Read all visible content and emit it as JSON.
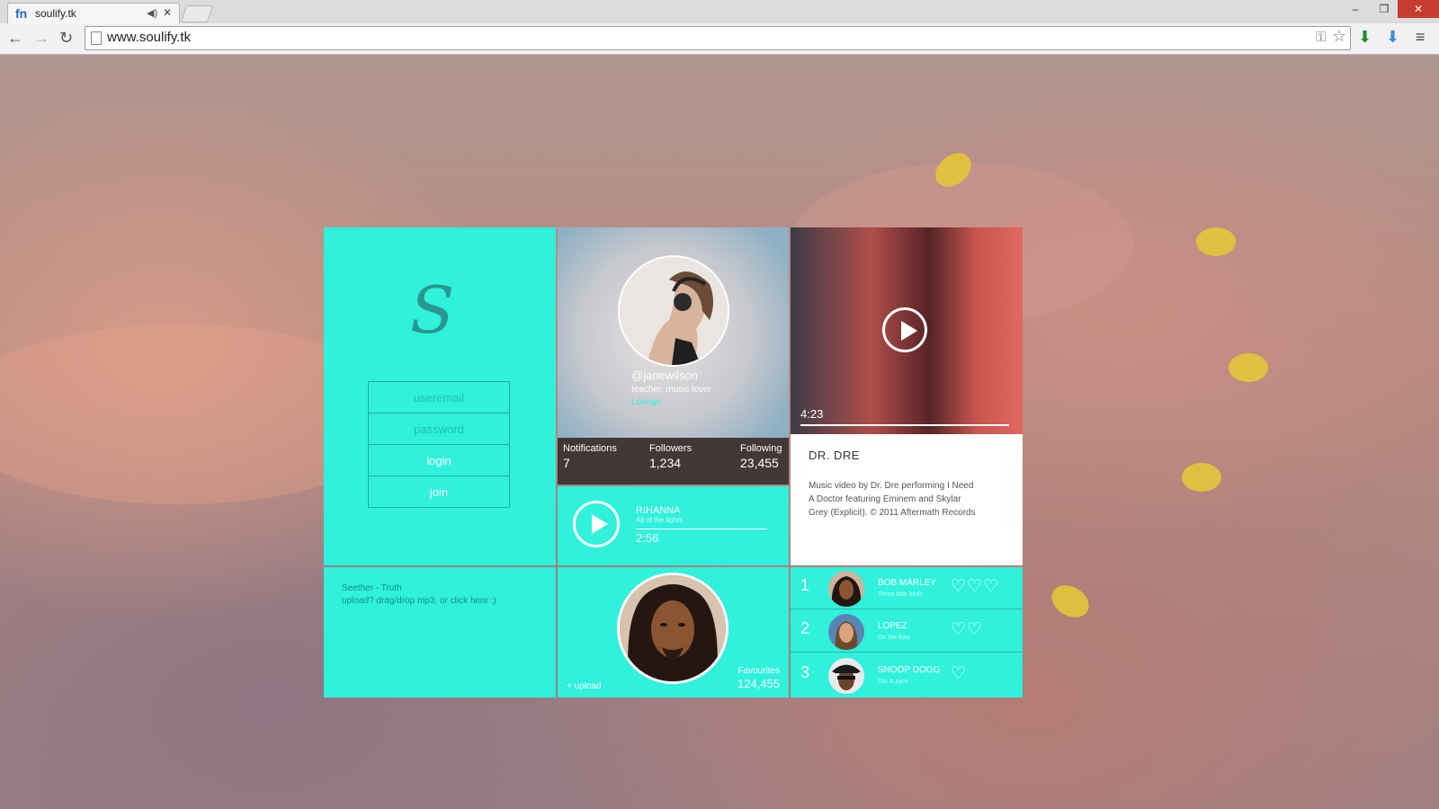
{
  "browser": {
    "tab_title": "soulify.tk",
    "favicon": "fn",
    "url": "www.soulify.tk",
    "window_controls": [
      "–",
      "❐",
      "✕"
    ]
  },
  "login": {
    "logo": "S",
    "email_placeholder": "useremail",
    "password_placeholder": "password",
    "login_label": "login",
    "join_label": "join"
  },
  "profile": {
    "username": "@janewilson",
    "bio": "teacher, music lover",
    "genre": "Lounge",
    "stats": [
      {
        "label": "Notifications",
        "value": "7"
      },
      {
        "label": "Followers",
        "value": "1,234"
      },
      {
        "label": "Following",
        "value": "23,455"
      }
    ]
  },
  "video": {
    "duration": "4:23",
    "title": "DR. DRE",
    "description": "Music video by Dr. Dre performing I Need A Doctor featuring Eminem and Skylar Grey (Explicit). © 2011 Aftermath Records"
  },
  "player": {
    "artist": "RIHANNA",
    "song": "All of the lights",
    "time": "2:56"
  },
  "upload": {
    "now_playing": "Seether - Truth",
    "instruction": "upload? drag/drop mp3, or click here :)"
  },
  "favourites": {
    "upload_label": "+ upload",
    "label": "Favourites",
    "count": "124,455"
  },
  "charts": [
    {
      "rank": "1",
      "artist": "BOB MARLEY",
      "song": "Three little birds",
      "hearts": "♡♡♡"
    },
    {
      "rank": "2",
      "artist": "LOPEZ",
      "song": "On the floor",
      "hearts": "♡♡"
    },
    {
      "rank": "3",
      "artist": "SNOOP DOGG",
      "song": "Gin & juice",
      "hearts": "♡"
    }
  ],
  "colors": {
    "accent": "#2ff1dc",
    "accent_dark": "#1cc2b0"
  }
}
